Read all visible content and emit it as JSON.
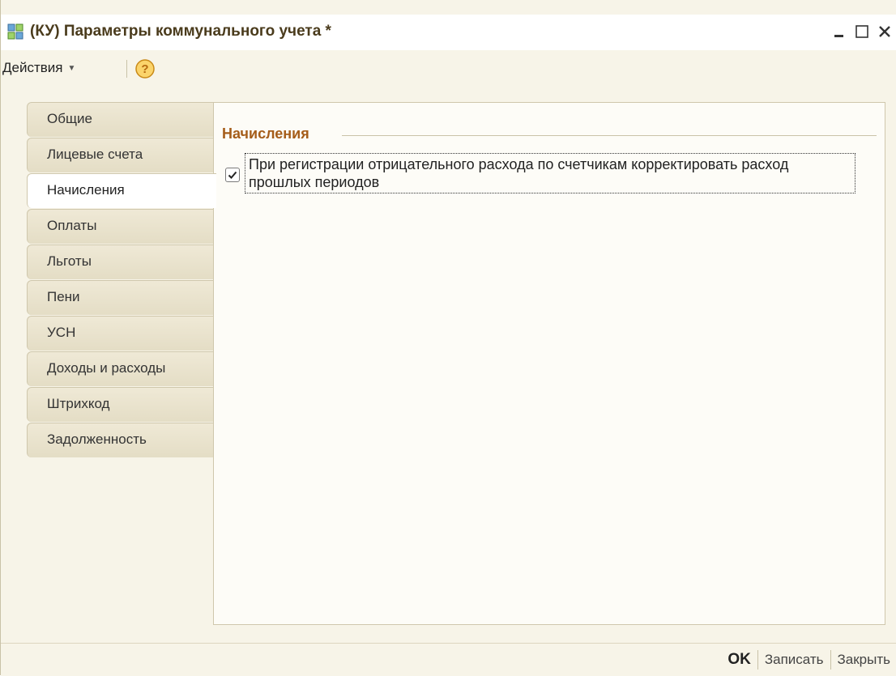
{
  "window": {
    "title": "(КУ) Параметры коммунального учета *",
    "icon": "grid-form-icon"
  },
  "toolbar": {
    "actions_label": "Действия",
    "help_icon": "help-icon"
  },
  "tabs": [
    {
      "label": "Общие",
      "active": false
    },
    {
      "label": "Лицевые счета",
      "active": false
    },
    {
      "label": "Начисления",
      "active": true
    },
    {
      "label": "Оплаты",
      "active": false
    },
    {
      "label": "Льготы",
      "active": false
    },
    {
      "label": "Пени",
      "active": false
    },
    {
      "label": "УСН",
      "active": false
    },
    {
      "label": "Доходы и расходы",
      "active": false
    },
    {
      "label": "Штрихкод",
      "active": false
    },
    {
      "label": "Задолженность",
      "active": false
    }
  ],
  "panel": {
    "group_title": "Начисления",
    "checkbox": {
      "checked": true,
      "label": "При регистрации отрицательного расхода по счетчикам корректировать расход прошлых периодов"
    }
  },
  "footer": {
    "ok_label": "OK",
    "save_label": "Записать",
    "close_label": "Закрыть"
  },
  "colors": {
    "background": "#f7f4e8",
    "group_title": "#a55d1a",
    "title_text": "#4a3b1c"
  }
}
